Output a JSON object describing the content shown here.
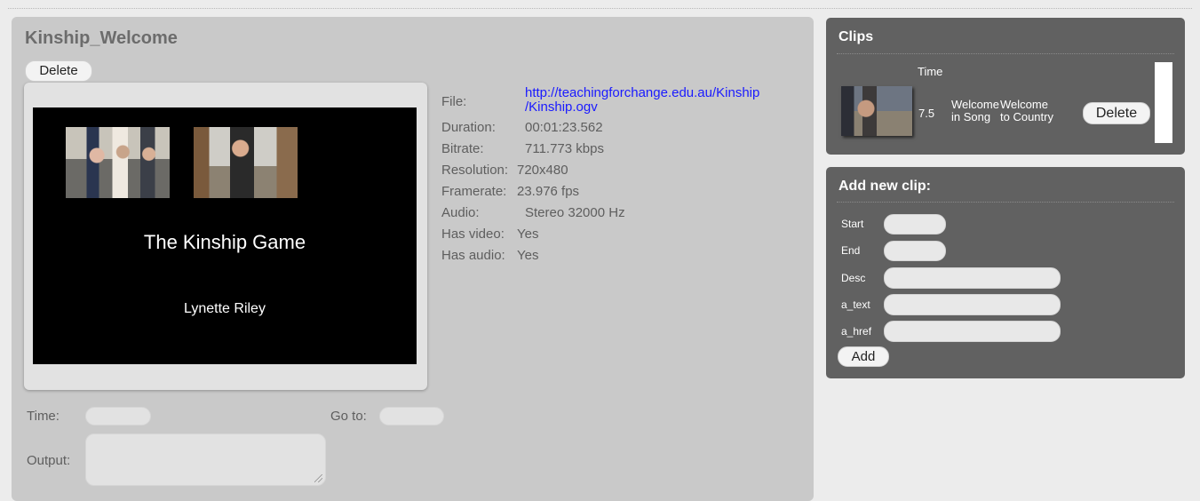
{
  "main": {
    "title": "Kinship_Welcome",
    "delete_label": "Delete",
    "video": {
      "title_text": "The Kinship Game",
      "author_text": "Lynette Riley"
    },
    "meta": [
      {
        "label": "File:",
        "value": "http://teachingforchange.edu.au/Kinship\n/Kinship.ogv"
      },
      {
        "label": "Duration:",
        "value": "00:01:23.562"
      },
      {
        "label": "Bitrate:",
        "value": "711.773 kbps"
      },
      {
        "label": "Resolution:",
        "value": "720x480"
      },
      {
        "label": "Framerate:",
        "value": "23.976 fps"
      },
      {
        "label": "Audio:",
        "value": "Stereo 32000 Hz"
      },
      {
        "label": "Has video:",
        "value": "Yes"
      },
      {
        "label": "Has audio:",
        "value": "Yes"
      }
    ],
    "time_label": "Time:",
    "goto_label": "Go to:",
    "output_label": "Output:"
  },
  "clips": {
    "heading": "Clips",
    "time_header": "Time",
    "items": [
      {
        "time": "7.5",
        "text1": "Welcome\nin Song",
        "text2": "Welcome\nto Country",
        "delete_label": "Delete"
      }
    ]
  },
  "add_clip": {
    "heading": "Add new clip:",
    "start_label": "Start",
    "end_label": "End",
    "desc_label": "Desc",
    "a_text_label": "a_text",
    "a_href_label": "a_href",
    "add_label": "Add"
  },
  "colors": {
    "page_bg": "#ececec",
    "main_panel": "#c9c9c9",
    "side_panel": "#616161",
    "link": "#1a1aff"
  }
}
